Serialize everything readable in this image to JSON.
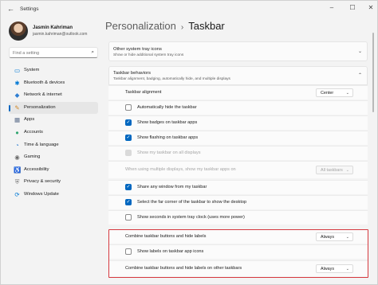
{
  "app": {
    "title": "Settings",
    "back_glyph": "←",
    "minimize_glyph": "–",
    "maximize_glyph": "☐",
    "close_glyph": "✕"
  },
  "profile": {
    "name": "Jasmin Kahriman",
    "email": "jasmin.kahriman@outlook.com"
  },
  "search": {
    "placeholder": "Find a setting",
    "icon": "⌕"
  },
  "sidebar": {
    "items": [
      {
        "label": "System",
        "icon": "▭",
        "color": "#0078d4"
      },
      {
        "label": "Bluetooth & devices",
        "icon": "✱",
        "color": "#0078d4"
      },
      {
        "label": "Network & internet",
        "icon": "◆",
        "color": "#2d7dd2"
      },
      {
        "label": "Personalization",
        "icon": "✎",
        "color": "#d08a2b"
      },
      {
        "label": "Apps",
        "icon": "▦",
        "color": "#5b6d8a"
      },
      {
        "label": "Accounts",
        "icon": "●",
        "color": "#2fa56f"
      },
      {
        "label": "Time & language",
        "icon": "◔",
        "color": "#2d7dd2"
      },
      {
        "label": "Gaming",
        "icon": "◉",
        "color": "#6b6b6b"
      },
      {
        "label": "Accessibility",
        "icon": "♿",
        "color": "#2d7dd2"
      },
      {
        "label": "Privacy & security",
        "icon": "⛨",
        "color": "#6b6b6b"
      },
      {
        "label": "Windows Update",
        "icon": "⟳",
        "color": "#0078d4"
      }
    ],
    "active_index": 3
  },
  "header": {
    "crumb": "Personalization",
    "separator": "›",
    "title": "Taskbar"
  },
  "cards": {
    "tray": {
      "title": "Other system tray icons",
      "subtitle": "Show or hide additional system tray icons",
      "chevron": "⌄"
    },
    "behaviors": {
      "title": "Taskbar behaviors",
      "subtitle": "Taskbar alignment, badging, automatically hide, and multiple displays",
      "chevron": "⌃"
    }
  },
  "settings": {
    "alignment": {
      "label": "Taskbar alignment",
      "value": "Center"
    },
    "auto_hide": {
      "label": "Automatically hide the taskbar",
      "checked": false
    },
    "badges": {
      "label": "Show badges on taskbar apps",
      "checked": true
    },
    "flashing": {
      "label": "Show flashing on taskbar apps",
      "checked": true
    },
    "all_displays": {
      "label": "Show my taskbar on all displays",
      "checked": false,
      "disabled": true
    },
    "multi_display": {
      "label": "When using multiple displays, show my taskbar apps on",
      "value": "All taskbars",
      "disabled": true
    },
    "share_window": {
      "label": "Share any window from my taskbar",
      "checked": true
    },
    "far_corner": {
      "label": "Select the far corner of the taskbar to show the desktop",
      "checked": true
    },
    "seconds": {
      "label": "Show seconds in system tray clock (uses more power)",
      "checked": false
    },
    "combine": {
      "label": "Combine taskbar buttons and hide labels",
      "value": "Always"
    },
    "icon_labels": {
      "label": "Show labels on taskbar app icons",
      "checked": false
    },
    "combine_other": {
      "label": "Combine taskbar buttons and hide labels on other taskbars",
      "value": "Always"
    }
  },
  "glyphs": {
    "check": "✓",
    "dropdown": "⌄"
  },
  "colors": {
    "accent": "#0067c0",
    "highlight_box": "#d6393f"
  }
}
